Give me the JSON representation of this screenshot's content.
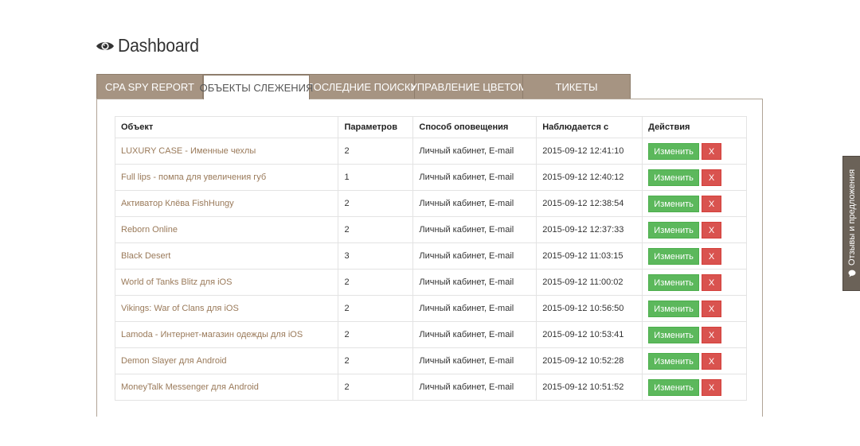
{
  "header": {
    "title": "Dashboard",
    "icon": "eye-icon"
  },
  "tabs": [
    {
      "label": "CPA SPY REPORT",
      "active": false
    },
    {
      "label": "ОБЪЕКТЫ СЛЕЖЕНИЯ",
      "active": true
    },
    {
      "label": "ПОСЛЕДНИЕ ПОИСКИ",
      "active": false
    },
    {
      "label": "УПРАВЛЕНИЕ ЦВЕТОМ",
      "active": false
    },
    {
      "label": "ТИКЕТЫ",
      "active": false
    }
  ],
  "table": {
    "columns": [
      "Объект",
      "Параметров",
      "Способ оповещения",
      "Наблюдается с",
      "Действия"
    ],
    "edit_label": "Изменить",
    "delete_label": "X",
    "rows": [
      {
        "object": "LUXURY CASE - Именные чехлы",
        "params": "2",
        "notify": "Личный кабинет, E-mail",
        "since": "2015-09-12 12:41:10"
      },
      {
        "object": "Full lips - помпа для увеличения губ",
        "params": "1",
        "notify": "Личный кабинет, E-mail",
        "since": "2015-09-12 12:40:12"
      },
      {
        "object": "Активатор Клёва FishHungy",
        "params": "2",
        "notify": "Личный кабинет, E-mail",
        "since": "2015-09-12 12:38:54"
      },
      {
        "object": "Reborn Online",
        "params": "2",
        "notify": "Личный кабинет, E-mail",
        "since": "2015-09-12 12:37:33"
      },
      {
        "object": "Black Desert",
        "params": "3",
        "notify": "Личный кабинет, E-mail",
        "since": "2015-09-12 11:03:15"
      },
      {
        "object": "World of Tanks Blitz для iOS",
        "params": "2",
        "notify": "Личный кабинет, E-mail",
        "since": "2015-09-12 11:00:02"
      },
      {
        "object": "Vikings: War of Clans для iOS",
        "params": "2",
        "notify": "Личный кабинет, E-mail",
        "since": "2015-09-12 10:56:50"
      },
      {
        "object": "Lamoda - Интернет-магазин одежды для iOS",
        "params": "2",
        "notify": "Личный кабинет, E-mail",
        "since": "2015-09-12 10:53:41"
      },
      {
        "object": "Demon Slayer для Android",
        "params": "2",
        "notify": "Личный кабинет, E-mail",
        "since": "2015-09-12 10:52:28"
      },
      {
        "object": "MoneyTalk Messenger для Android",
        "params": "2",
        "notify": "Личный кабинет, E-mail",
        "since": "2015-09-12 10:51:52"
      }
    ]
  },
  "feedback": {
    "label": "Отзывы и предложения",
    "icon": "speech-bubble-icon"
  },
  "colors": {
    "tab_bg": "#a69482",
    "link": "#9a7a5a",
    "edit_button": "#5cb85c",
    "delete_button": "#d9534f",
    "feedback_bg": "#6b6258"
  }
}
